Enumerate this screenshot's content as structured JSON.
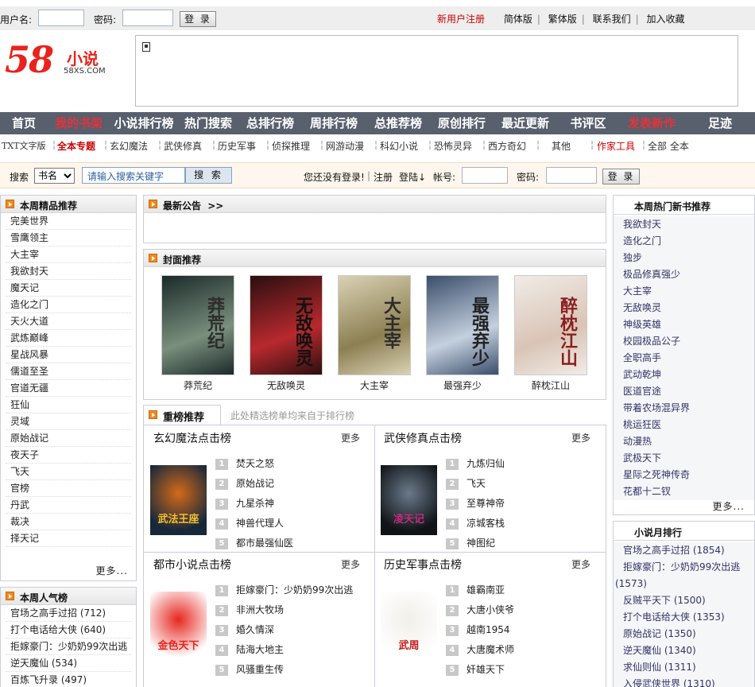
{
  "topbar": {
    "username_label": "用户名:",
    "password_label": "密码:",
    "login_button": "登 录",
    "links": [
      "新用户注册",
      "简体版",
      "繁体版",
      "联系我们",
      "加入收藏"
    ]
  },
  "logo": {
    "number": "58",
    "word": "小说",
    "domain": "58XS.COM"
  },
  "nav": {
    "items": [
      "首页",
      "我的书架",
      "小说排行榜",
      "热门搜索",
      "总排行榜",
      "周排行榜",
      "总推荐榜",
      "原创排行",
      "最近更新",
      "书评区",
      "发表新作",
      "足迹"
    ]
  },
  "categories": {
    "items": [
      "TXT文字版",
      "全本专题",
      "玄幻魔法",
      "武侠修真",
      "历史军事",
      "侦探推理",
      "网游动漫",
      "科幻小说",
      "恐怖灵异",
      "西方奇幻",
      "其他",
      "作家工具",
      "全部 全本"
    ]
  },
  "search": {
    "label": "搜索",
    "select_value": "书名",
    "placeholder": "请输入搜索关键字",
    "button": "搜 索",
    "not_logged": "您还没有登录!",
    "register": "注册",
    "login_arrow": "登陆↓",
    "account_label": "帐号:",
    "password_label": "密码:",
    "login_button": "登 录"
  },
  "left_weekly": {
    "title": "本周精品推荐",
    "items": [
      "完美世界",
      "雪鹰领主",
      "大主宰",
      "我欲封天",
      "魔天记",
      "造化之门",
      "天火大道",
      "武炼巅峰",
      "星战风暴",
      "儒道至圣",
      "官道无疆",
      "狂仙",
      "灵域",
      "原始战记",
      "夜天子",
      "飞天",
      "官榜",
      "丹武",
      "裁决",
      "择天记"
    ],
    "more": "更多..."
  },
  "left_popular": {
    "title": "本周人气榜",
    "items": [
      "官场之高手过招 (712)",
      "打个电话给大侠 (640)",
      "拒嫁豪门：少奶奶99次出逃 (5",
      "逆天魔仙 (534)",
      "百炼飞升录 (497)"
    ]
  },
  "announcement": {
    "title": "最新公告",
    "arrows": ">>"
  },
  "covers": {
    "title": "封面推荐",
    "books": [
      {
        "name": "莽荒纪",
        "cover_text": "莽荒纪"
      },
      {
        "name": "无敌唤灵",
        "cover_text": "无敌唤灵"
      },
      {
        "name": "大主宰",
        "cover_text": "大主宰"
      },
      {
        "name": "最强弃少",
        "cover_text": "最强弃少"
      },
      {
        "name": "醉枕江山",
        "cover_text": "醉枕江山"
      }
    ]
  },
  "ranking": {
    "title": "重榜推荐",
    "subtitle": "此处精选榜单均来自于排行榜",
    "more_label": "更多",
    "sections": [
      {
        "title": "玄幻魔法点击榜",
        "cover_text": "武法王座",
        "items": [
          "焚天之怒",
          "原始战记",
          "九星杀神",
          "神兽代理人",
          "都市最强仙医"
        ]
      },
      {
        "title": "武侠修真点击榜",
        "cover_text": "凌天记",
        "items": [
          "九炼归仙",
          "飞天",
          "至尊神帝",
          "凉城客栈",
          "神图纪"
        ]
      },
      {
        "title": "都市小说点击榜",
        "cover_text": "金色天下",
        "items": [
          "拒嫁豪门：少奶奶99次出逃",
          "非洲大牧场",
          "婚久情深",
          "陆海大地主",
          "风骚重生传"
        ]
      },
      {
        "title": "历史军事点击榜",
        "cover_text": "武周",
        "items": [
          "雄霸南亚",
          "大唐小侠爷",
          "越南1954",
          "大唐魔术师",
          "奸雄天下"
        ]
      }
    ],
    "numbers": [
      "1",
      "2",
      "3",
      "4",
      "5"
    ]
  },
  "right_hot": {
    "title": "本周热门新书推荐",
    "items": [
      "我欲封天",
      "造化之门",
      "独步",
      "极品修真强少",
      "大主宰",
      "无敌唤灵",
      "神级英雄",
      "校园极品公子",
      "全职高手",
      "武动乾坤",
      "医道官途",
      "带着农场混异界",
      "桃运狂医",
      "动漫热",
      "武极天下",
      "星际之死神传奇",
      "花都十二钗"
    ],
    "more": "更多..."
  },
  "right_month": {
    "title": "小说月排行",
    "items": [
      "官场之高手过招 (1854)",
      "拒嫁豪门：少奶奶99次出逃",
      "(1573)",
      "反贼平天下 (1500)",
      "打个电话给大侠 (1353)",
      "原始战记 (1350)",
      "逆天魔仙 (1340)",
      "求仙则仙 (1311)",
      "入侵武侠世界 (1310)"
    ]
  },
  "colors": {
    "nav_bg": "#585f6d",
    "accent_red": "#e4333a",
    "brand_red": "#e8221d",
    "orange_icon": "#f08a1c"
  }
}
